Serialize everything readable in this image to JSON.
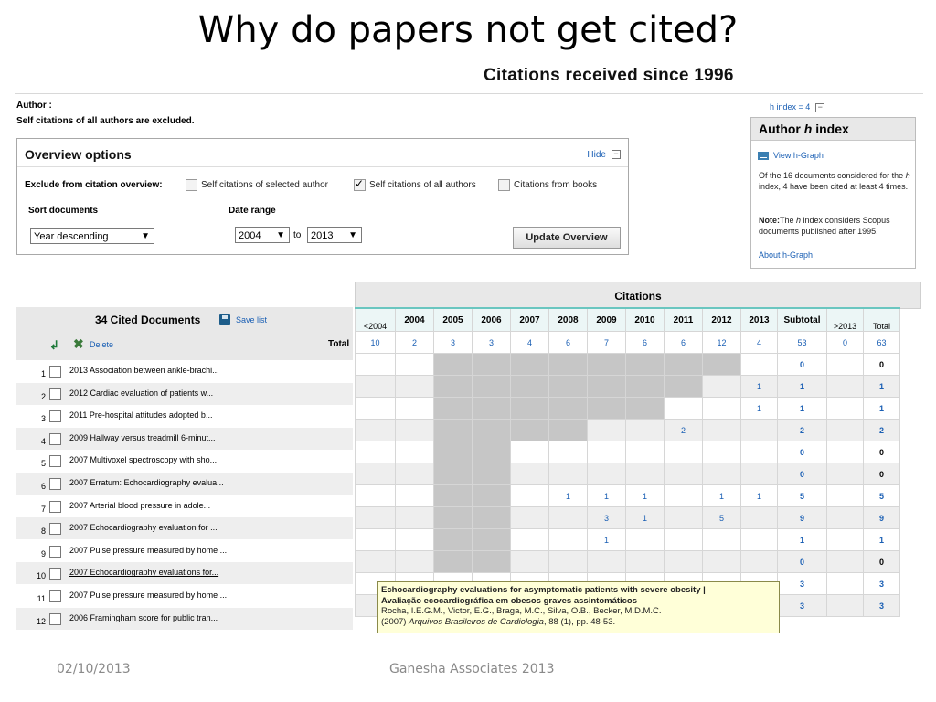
{
  "slide": {
    "title": "Why do papers not get cited?",
    "footer_date": "02/10/2013",
    "footer_org": "Ganesha Associates 2013"
  },
  "screen": {
    "heading": "Citations received since 1996",
    "author_label": "Author :",
    "self_citations_note": "Self citations of all authors are excluded."
  },
  "overview": {
    "title": "Overview options",
    "hide_label": "Hide",
    "exclude_label": "Exclude from citation overview:",
    "options": [
      {
        "label": "Self citations of selected author",
        "checked": false
      },
      {
        "label": "Self citations of all authors",
        "checked": true
      },
      {
        "label": "Citations from books",
        "checked": false
      }
    ],
    "sort_label": "Sort documents",
    "sort_value": "Year descending",
    "date_range_label": "Date range",
    "date_from": "2004",
    "to_label": "to",
    "date_to": "2013",
    "update_button": "Update Overview"
  },
  "hindex": {
    "top_label": "h index = 4",
    "panel_title_prefix": "Author ",
    "panel_title_h": "h",
    "panel_title_suffix": " index",
    "view_graph": "View h-Graph",
    "desc_1": "Of the 16 documents considered for the ",
    "desc_h": "h",
    "desc_2": " index, 4 have been cited at least 4 times.",
    "note_label": "Note:",
    "note_1": "The ",
    "note_h": "h",
    "note_2": " index considers Scopus documents published after 1995.",
    "about": "About h-Graph"
  },
  "docs": {
    "title": "34 Cited Documents",
    "save_list": "Save list",
    "delete_label": "Delete",
    "total_label": "Total",
    "citations_label": "Citations",
    "year_cols": [
      "<2004",
      "2004",
      "2005",
      "2006",
      "2007",
      "2008",
      "2009",
      "2010",
      "2011",
      "2012",
      "2013",
      "Subtotal",
      ">2013",
      "Total"
    ],
    "totals": [
      "10",
      "2",
      "3",
      "3",
      "4",
      "6",
      "7",
      "6",
      "6",
      "12",
      "4",
      "53",
      "0",
      "63"
    ],
    "rows": [
      {
        "num": "1",
        "text": "2013  Association between ankle-brachi...",
        "cells": [
          "",
          "",
          "",
          "",
          "",
          "",
          "",
          "",
          "",
          "",
          "",
          "0",
          "",
          "0"
        ]
      },
      {
        "num": "2",
        "text": "2012  Cardiac evaluation of patients w...",
        "cells": [
          "",
          "",
          "",
          "",
          "",
          "",
          "",
          "",
          "",
          "",
          "1",
          "1",
          "",
          "1"
        ]
      },
      {
        "num": "3",
        "text": "2011  Pre-hospital attitudes adopted b...",
        "cells": [
          "",
          "",
          "",
          "",
          "",
          "",
          "",
          "",
          "",
          "",
          "1",
          "1",
          "",
          "1"
        ]
      },
      {
        "num": "4",
        "text": "2009  Hallway versus treadmill 6-minut...",
        "cells": [
          "",
          "",
          "",
          "",
          "",
          "",
          "",
          "",
          "2",
          "",
          "",
          "2",
          "",
          "2"
        ]
      },
      {
        "num": "5",
        "text": "2007  Multivoxel spectroscopy with sho...",
        "cells": [
          "",
          "",
          "",
          "",
          "",
          "",
          "",
          "",
          "",
          "",
          "",
          "0",
          "",
          "0"
        ]
      },
      {
        "num": "6",
        "text": "2007  Erratum: Echocardiography evalua...",
        "cells": [
          "",
          "",
          "",
          "",
          "",
          "",
          "",
          "",
          "",
          "",
          "",
          "0",
          "",
          "0"
        ]
      },
      {
        "num": "7",
        "text": "2007  Arterial blood pressure in adole...",
        "cells": [
          "",
          "",
          "",
          "",
          "",
          "1",
          "1",
          "1",
          "",
          "1",
          "1",
          "5",
          "",
          "5"
        ]
      },
      {
        "num": "8",
        "text": "2007  Echocardiography evaluation for ...",
        "cells": [
          "",
          "",
          "",
          "",
          "",
          "",
          "3",
          "1",
          "",
          "5",
          "",
          "9",
          "",
          "9"
        ]
      },
      {
        "num": "9",
        "text": "2007  Pulse pressure measured by home ...",
        "cells": [
          "",
          "",
          "",
          "",
          "",
          "",
          "1",
          "",
          "",
          "",
          "",
          "1",
          "",
          "1"
        ]
      },
      {
        "num": "10",
        "text": "2007  Echocardiography evaluations for...",
        "cells": [
          "",
          "",
          "",
          "",
          "",
          "",
          "",
          "",
          "",
          "",
          "",
          "0",
          "",
          "0"
        ]
      },
      {
        "num": "11",
        "text": "2007  Pulse pressure measured by home ...",
        "cells": [
          "",
          "",
          "",
          "",
          "",
          "",
          "",
          "",
          "",
          "",
          "",
          "3",
          "",
          "3"
        ]
      },
      {
        "num": "12",
        "text": "2006  Framingham score for public tran...",
        "cells": [
          "",
          "",
          "",
          "",
          "",
          "",
          "",
          "",
          "",
          "",
          "",
          "3",
          "",
          "3"
        ]
      }
    ]
  },
  "tooltip": {
    "title_line": "Echocardiography evaluations for asymptomatic patients with severe obesity |",
    "title_line2": "Avaliação ecocardiográfica em obesos graves assintomáticos",
    "authors": "Rocha, I.E.G.M., Victor, E.G., Braga, M.C., Silva, O.B., Becker, M.D.M.C.",
    "year": "(2007) ",
    "journal": "Arquivos Brasileiros de Cardiologia",
    "vol": ", 88 (1), pp. 48-53."
  }
}
